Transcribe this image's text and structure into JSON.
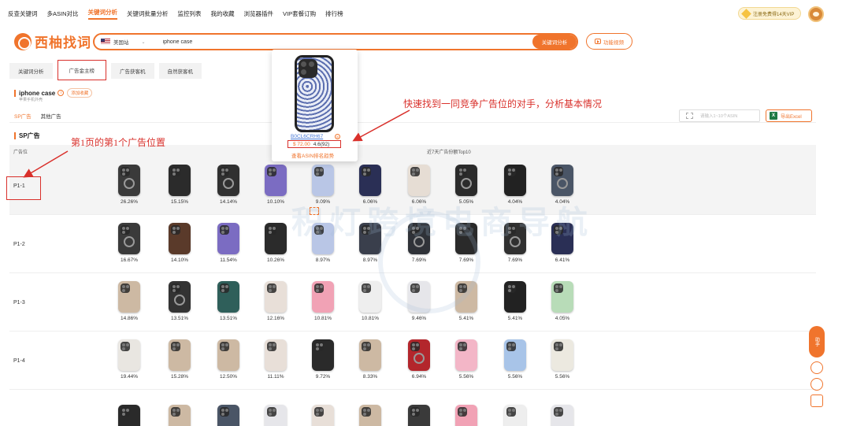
{
  "nav": {
    "items": [
      "反查关键词",
      "多ASIN对比",
      "关键词分析",
      "关键词批量分析",
      "监控列表",
      "我的收藏",
      "浏览器插件",
      "VIP套餐订购",
      "排行榜"
    ],
    "active_index": 2,
    "vip_label": "注册免费得14天VIP"
  },
  "brand": {
    "name": "西柚找词",
    "color": "#f0742c"
  },
  "search": {
    "market": "美国站",
    "query": "iphone case",
    "button": "关键词分析",
    "video_button": "功能视频"
  },
  "tabs": [
    "关键词分析",
    "广告金主榜",
    "广告获客机",
    "自然获客机"
  ],
  "active_tab": 1,
  "keyword": {
    "title": "iphone case",
    "add_label": "添加收藏",
    "subtitle": "苹果手机外壳"
  },
  "subtabs": [
    "SP广告",
    "其他广告"
  ],
  "asin_placeholder": "请输入1~10个ASIN",
  "export_label": "导出Excel",
  "section_title": "SP广告",
  "table": {
    "col_position": "广告位",
    "col_top": "近7天广告份额Top10",
    "rows": [
      {
        "pos": "P1-1",
        "items": [
          {
            "pct": "26.26%",
            "color": "#3a3a3a",
            "ring": true
          },
          {
            "pct": "15.15%",
            "color": "#2b2b2b",
            "ring": false
          },
          {
            "pct": "14.14%",
            "color": "#303030",
            "ring": true
          },
          {
            "pct": "10.10%",
            "color": "#7b6cc2",
            "ring": false
          },
          {
            "pct": "9.09%",
            "color": "#b9c6e6",
            "ring": false
          },
          {
            "pct": "6.06%",
            "color": "#2a2f55",
            "ring": false
          },
          {
            "pct": "6.06%",
            "color": "#e6ddd4",
            "ring": false
          },
          {
            "pct": "5.05%",
            "color": "#2b2b2b",
            "ring": true
          },
          {
            "pct": "4.04%",
            "color": "#222222",
            "ring": false
          },
          {
            "pct": "4.04%",
            "color": "#4a5566",
            "ring": true
          }
        ]
      },
      {
        "pos": "P1-2",
        "items": [
          {
            "pct": "16.67%",
            "color": "#3a3a3a",
            "ring": true
          },
          {
            "pct": "14.10%",
            "color": "#5a3a2a",
            "ring": false
          },
          {
            "pct": "11.54%",
            "color": "#7b6cc2",
            "ring": false
          },
          {
            "pct": "10.26%",
            "color": "#2b2b2b",
            "ring": false
          },
          {
            "pct": "8.97%",
            "color": "#b9c6e6",
            "ring": false
          },
          {
            "pct": "8.97%",
            "color": "#3a3f4c",
            "ring": false
          },
          {
            "pct": "7.69%",
            "color": "#2f3238",
            "ring": true
          },
          {
            "pct": "7.69%",
            "color": "#2a2a2a",
            "ring": false
          },
          {
            "pct": "7.69%",
            "color": "#303030",
            "ring": true
          },
          {
            "pct": "6.41%",
            "color": "#2a2f55",
            "ring": false
          }
        ]
      },
      {
        "pos": "P1-3",
        "items": [
          {
            "pct": "14.86%",
            "color": "#cdb9a3",
            "ring": false
          },
          {
            "pct": "13.51%",
            "color": "#333333",
            "ring": true
          },
          {
            "pct": "13.51%",
            "color": "#2f5f5a",
            "ring": false
          },
          {
            "pct": "12.16%",
            "color": "#e8dfd8",
            "ring": false
          },
          {
            "pct": "10.81%",
            "color": "#f1a2b5",
            "ring": false
          },
          {
            "pct": "10.81%",
            "color": "#eeeeee",
            "ring": false
          },
          {
            "pct": "9.46%",
            "color": "#e6e6ea",
            "ring": false
          },
          {
            "pct": "5.41%",
            "color": "#cdb9a3",
            "ring": false
          },
          {
            "pct": "5.41%",
            "color": "#222222",
            "ring": false
          },
          {
            "pct": "4.05%",
            "color": "#b8dcb8",
            "ring": false
          }
        ]
      },
      {
        "pos": "P1-4",
        "items": [
          {
            "pct": "19.44%",
            "color": "#e9e6e1",
            "ring": false
          },
          {
            "pct": "15.28%",
            "color": "#cdb9a3",
            "ring": false
          },
          {
            "pct": "12.50%",
            "color": "#cdb9a3",
            "ring": false
          },
          {
            "pct": "11.11%",
            "color": "#e8dfd8",
            "ring": false
          },
          {
            "pct": "9.72%",
            "color": "#2a2a2a",
            "ring": false
          },
          {
            "pct": "8.33%",
            "color": "#cdb9a3",
            "ring": false
          },
          {
            "pct": "6.94%",
            "color": "#b3262c",
            "ring": true
          },
          {
            "pct": "5.56%",
            "color": "#f3b6c7",
            "ring": false
          },
          {
            "pct": "5.56%",
            "color": "#a8c4e8",
            "ring": false
          },
          {
            "pct": "5.56%",
            "color": "#ece9e0",
            "ring": false
          }
        ]
      }
    ],
    "partial_row_colors": [
      "#2a2a2a",
      "#cdb9a3",
      "#4a5566",
      "#e6e6ea",
      "#e8dfd8",
      "#cdb9a3",
      "#3a3a3a",
      "#f1a2b5",
      "#eeeeee",
      "#e6e6ea"
    ]
  },
  "popup": {
    "asin": "B0CL6CRH67",
    "price": "$ 72.00",
    "rating": "4.6(92)",
    "link": "查看ASIN排名趋势"
  },
  "annotations": {
    "top": "快速找到一同竞争广告位的对手，分析基本情况",
    "left": "第1页的第1个广告位置"
  },
  "watermark": "积灯跨境电商导航",
  "side_float": "助手"
}
